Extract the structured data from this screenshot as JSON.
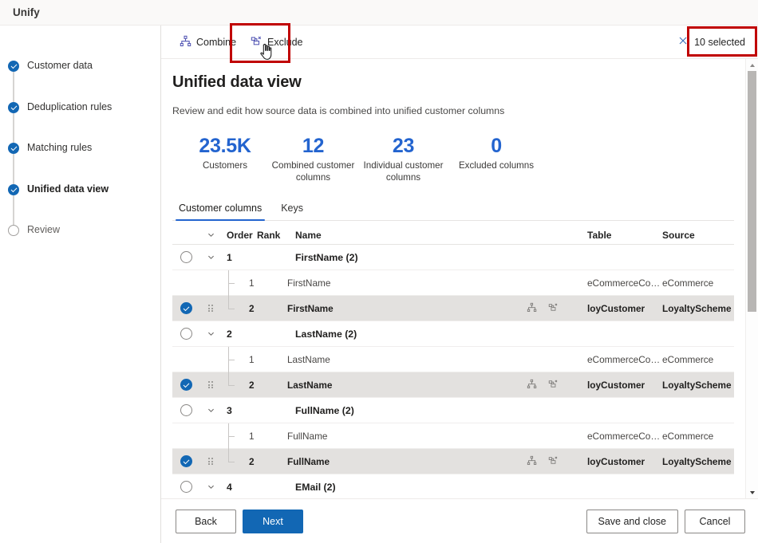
{
  "window": {
    "title": "Unify"
  },
  "rail": {
    "steps": [
      {
        "label": "Customer data",
        "state": "done"
      },
      {
        "label": "Deduplication rules",
        "state": "done"
      },
      {
        "label": "Matching rules",
        "state": "done"
      },
      {
        "label": "Unified data view",
        "state": "active"
      },
      {
        "label": "Review",
        "state": "pending"
      }
    ]
  },
  "commandbar": {
    "combine_label": "Combine",
    "exclude_label": "Exclude",
    "selected_label": "10 selected"
  },
  "page": {
    "title": "Unified data view",
    "subtitle": "Review and edit how source data is combined into unified customer columns"
  },
  "stats": [
    {
      "value": "23.5K",
      "label": "Customers"
    },
    {
      "value": "12",
      "label": "Combined customer columns"
    },
    {
      "value": "23",
      "label": "Individual customer columns"
    },
    {
      "value": "0",
      "label": "Excluded columns"
    }
  ],
  "tabs": [
    {
      "label": "Customer columns",
      "active": true
    },
    {
      "label": "Keys",
      "active": false
    }
  ],
  "grid": {
    "headers": {
      "order": "Order",
      "rank": "Rank",
      "name": "Name",
      "table": "Table",
      "source": "Source"
    },
    "rows": [
      {
        "type": "group",
        "checked": false,
        "order": "1",
        "name": "FirstName (2)"
      },
      {
        "type": "child",
        "checked": false,
        "selected": false,
        "rank": "1",
        "name": "FirstName",
        "table": "eCommerceConta…",
        "source": "eCommerce",
        "tree": "mid"
      },
      {
        "type": "child",
        "checked": true,
        "selected": true,
        "rank": "2",
        "name": "FirstName",
        "table": "loyCustomer",
        "source": "LoyaltyScheme",
        "tree": "last"
      },
      {
        "type": "group",
        "checked": false,
        "order": "2",
        "name": "LastName (2)"
      },
      {
        "type": "child",
        "checked": false,
        "selected": false,
        "rank": "1",
        "name": "LastName",
        "table": "eCommerceConta…",
        "source": "eCommerce",
        "tree": "mid"
      },
      {
        "type": "child",
        "checked": true,
        "selected": true,
        "rank": "2",
        "name": "LastName",
        "table": "loyCustomer",
        "source": "LoyaltyScheme",
        "tree": "last"
      },
      {
        "type": "group",
        "checked": false,
        "order": "3",
        "name": "FullName (2)"
      },
      {
        "type": "child",
        "checked": false,
        "selected": false,
        "rank": "1",
        "name": "FullName",
        "table": "eCommerceConta…",
        "source": "eCommerce",
        "tree": "mid"
      },
      {
        "type": "child",
        "checked": true,
        "selected": true,
        "rank": "2",
        "name": "FullName",
        "table": "loyCustomer",
        "source": "LoyaltyScheme",
        "tree": "last"
      },
      {
        "type": "group",
        "checked": false,
        "order": "4",
        "name": "EMail (2)"
      }
    ]
  },
  "footer": {
    "back": "Back",
    "next": "Next",
    "save_and_close": "Save and close",
    "cancel": "Cancel"
  },
  "colors": {
    "brand_blue": "#1267b4",
    "stat_blue": "#2364cf",
    "annotation_red": "#c00000",
    "selected_row": "#e3e1df"
  }
}
